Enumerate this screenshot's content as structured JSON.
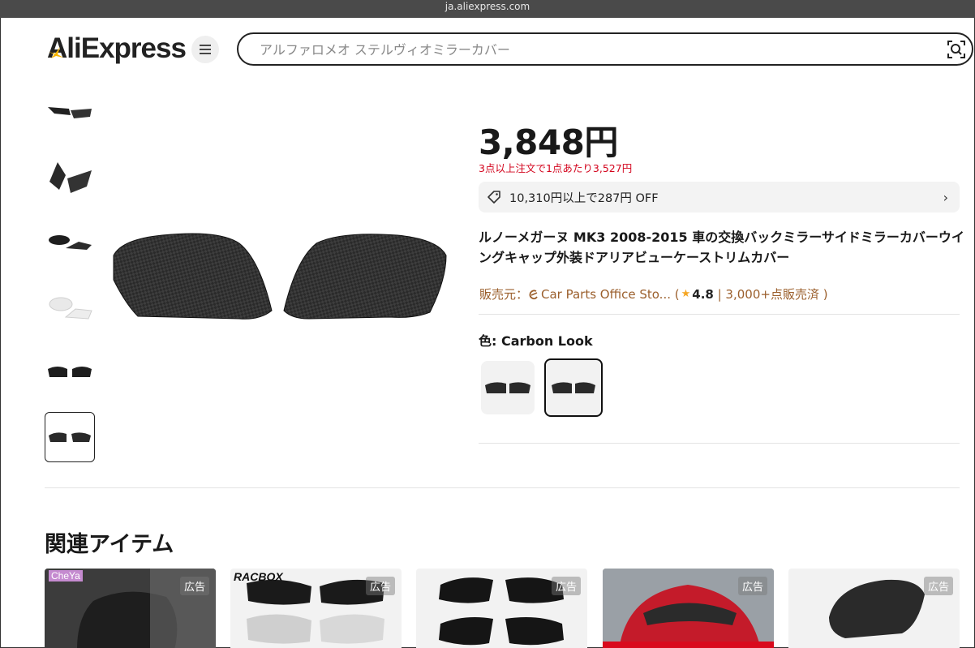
{
  "browser": {
    "url": "ja.aliexpress.com"
  },
  "header": {
    "logo": "AliExpress",
    "search_placeholder": "アルファロメオ ステルヴィオミラーカバー"
  },
  "product": {
    "price": "3,848円",
    "bulk_price_note": "3点以上注文で1点あたり3,527円",
    "coupon": "10,310円以上で287円 OFF",
    "title": "ルノーメガーヌ MK3 2008-2015 車の交換バックミラーサイドミラーカバーウイングキャップ外装ドアリアビューケーストリムカバー",
    "seller_label": "販売元：",
    "seller_name": "Car Parts Office Sto...",
    "rating_open": " (",
    "rating": "4.8",
    "sold": " | 3,000+点販売済 )",
    "color_label": "色: Carbon Look"
  },
  "related": {
    "title": "関連アイテム",
    "ad_label": "広告",
    "cards": [
      {
        "brand": "CheYa"
      },
      {
        "brand": "RACBOX"
      },
      {
        "brand": ""
      },
      {
        "brand": ""
      },
      {
        "brand": ""
      }
    ]
  },
  "colors": {
    "price_red": "#d3031c",
    "seller_brown": "#9b5f2c",
    "star": "#f5a623"
  }
}
